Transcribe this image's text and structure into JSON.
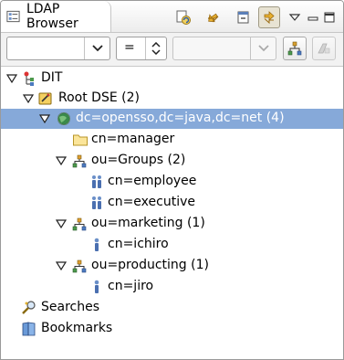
{
  "view": {
    "title": "LDAP Browser",
    "toolbar_icons": [
      "refresh-icon",
      "link-with-editor-icon",
      "collapse-all-icon",
      "link-icon",
      "view-menu-icon",
      "minimize-icon",
      "maximize-icon"
    ]
  },
  "filter": {
    "attribute_value": "",
    "operator_value": "=",
    "value_value": ""
  },
  "tree": [
    {
      "label": "DIT",
      "icon": "dit-icon",
      "expanded": true
    },
    {
      "label": "Root DSE (2)",
      "icon": "root-dse-icon",
      "expanded": true
    },
    {
      "label": "dc=opensso,dc=java,dc=net (4)",
      "icon": "globe-icon",
      "expanded": true,
      "selected": true
    },
    {
      "label": "cn=manager",
      "icon": "folder-icon"
    },
    {
      "label": "ou=Groups (2)",
      "icon": "org-unit-icon",
      "expanded": true
    },
    {
      "label": "cn=employee",
      "icon": "group-icon"
    },
    {
      "label": "cn=executive",
      "icon": "group-icon"
    },
    {
      "label": "ou=marketing (1)",
      "icon": "org-unit-icon",
      "expanded": true
    },
    {
      "label": "cn=ichiro",
      "icon": "person-icon"
    },
    {
      "label": "ou=producting (1)",
      "icon": "org-unit-icon",
      "expanded": true
    },
    {
      "label": "cn=jiro",
      "icon": "person-icon"
    },
    {
      "label": "Searches",
      "icon": "searches-icon"
    },
    {
      "label": "Bookmarks",
      "icon": "bookmarks-icon"
    }
  ],
  "colors": {
    "selection": "#86a9d9",
    "selection_text": "#ffffff"
  }
}
